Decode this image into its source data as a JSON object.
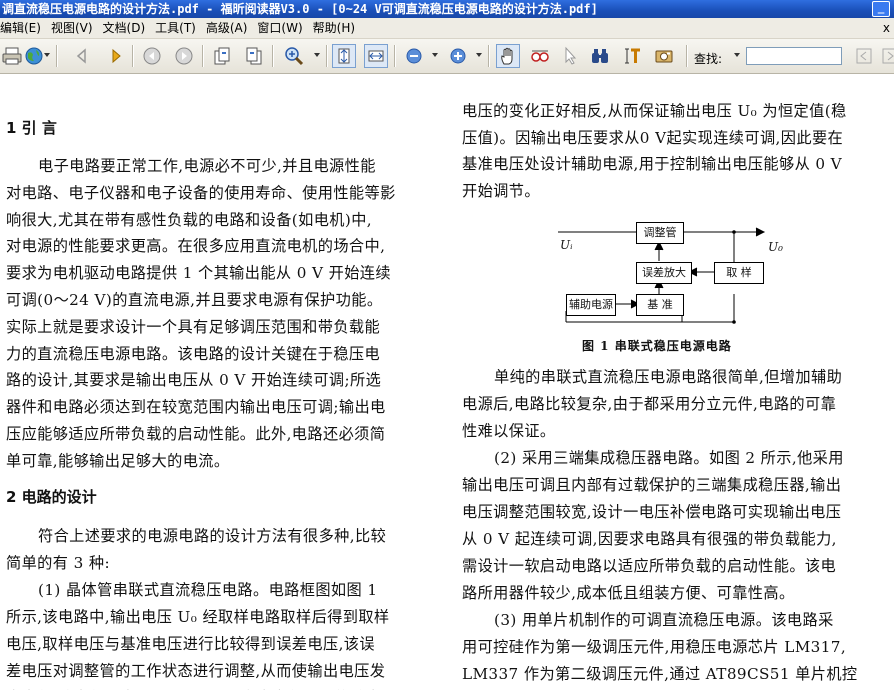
{
  "window": {
    "title": "调直流稳压电源电路的设计方法.pdf - 福昕阅读器V3.0 - [0~24 V可调直流稳压电源电路的设计方法.pdf]"
  },
  "menu": [
    "编辑(E)",
    "视图(V)",
    "文档(D)",
    "工具(T)",
    "高级(A)",
    "窗口(W)",
    "帮助(H)"
  ],
  "menu_right": "x",
  "toolbar": {
    "search_label": "查找:",
    "search_value": ""
  },
  "left_column": {
    "section1_heading": "1  引  言",
    "section1_lines": [
      "电子电路要正常工作,电源必不可少,并且电源性能",
      "对电路、电子仪器和电子设备的使用寿命、使用性能等影",
      "响很大,尤其在带有感性负载的电路和设备(如电机)中,",
      "对电源的性能要求更高。在很多应用直流电机的场合中,",
      "要求为电机驱动电路提供 1 个其输出能从 0 V 开始连续",
      "可调(0～24 V)的直流电源,并且要求电源有保护功能。",
      "实际上就是要求设计一个具有足够调压范围和带负载能",
      "力的直流稳压电源电路。该电路的设计关键在于稳压电",
      "路的设计,其要求是输出电压从 0 V 开始连续可调;所选",
      "器件和电路必须达到在较宽范围内输出电压可调;输出电",
      "压应能够适应所带负载的启动性能。此外,电路还必须简",
      "单可靠,能够输出足够大的电流。"
    ],
    "section2_heading": "2  电路的设计",
    "section2_lines": [
      "符合上述要求的电源电路的设计方法有很多种,比较",
      "简单的有 3 种:",
      "(1) 晶体管串联式直流稳压电路。电路框图如图 1",
      "所示,该电路中,输出电压 U₀ 经取样电路取样后得到取样",
      "电压,取样电压与基准电压进行比较得到误差电压,该误",
      "差电压对调整管的工作状态进行调整,从而使输出电压发",
      "生变化,该变化与由于供电电压 Uᵢ 发生变化引起的输出"
    ]
  },
  "right_column": {
    "top_lines": [
      "电压的变化正好相反,从而保证输出电压 U₀ 为恒定值(稳",
      "压值)。因输出电压要求从0 V起实现连续可调,因此要在",
      "基准电压处设计辅助电源,用于控制输出电压能够从 0 V",
      "开始调节。"
    ],
    "diagram": {
      "adjust": "调整管",
      "error_amp": "误差放大",
      "sample": "取  样",
      "aux_power": "辅助电源",
      "reference": "基  准",
      "input_label": "Uᵢ",
      "output_label": "U₀"
    },
    "figure_caption": "图 1   串联式稳压电源电路",
    "bottom_lines": [
      "单纯的串联式直流稳压电源电路很简单,但增加辅助",
      "电源后,电路比较复杂,由于都采用分立元件,电路的可靠",
      "性难以保证。",
      "(2) 采用三端集成稳压器电路。如图 2 所示,他采用",
      "输出电压可调且内部有过载保护的三端集成稳压器,输出",
      "电压调整范围较宽,设计一电压补偿电路可实现输出电压",
      "从 0 V 起连续可调,因要求电路具有很强的带负载能力,",
      "需设计一软启动电路以适应所带负载的启动性能。该电",
      "路所用器件较少,成本低且组装方便、可靠性高。",
      "(3) 用单片机制作的可调直流稳压电源。该电路采",
      "用可控硅作为第一级调压元件,用稳压电源芯片 LM317,",
      "LM337 作为第二级调压元件,通过 AT89CS51 单片机控",
      "制继电器改变电阻网络的阻值,从而改变调压元件的外围"
    ]
  }
}
